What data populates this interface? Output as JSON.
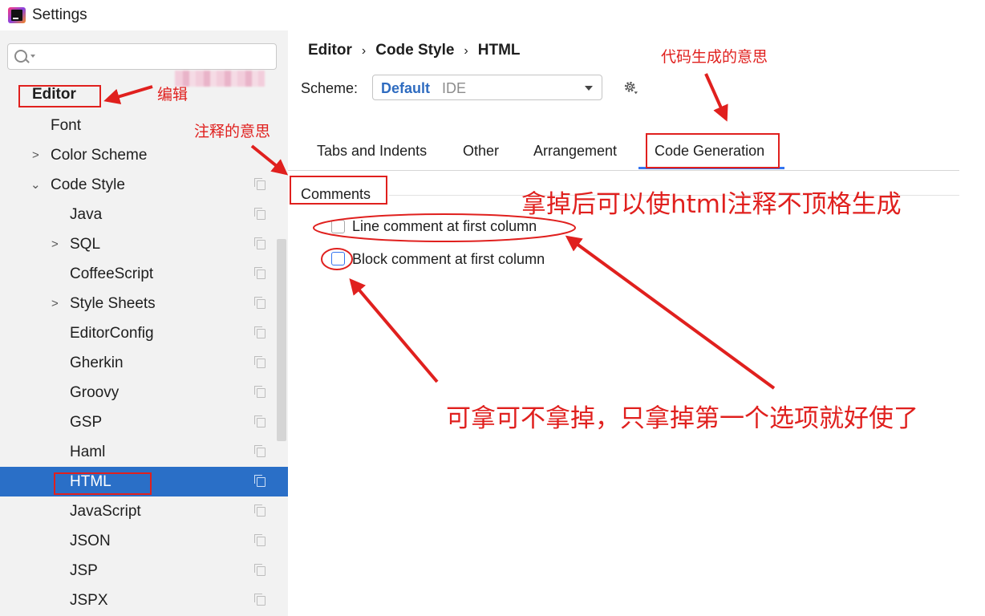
{
  "window": {
    "title": "Settings"
  },
  "search": {
    "placeholder": ""
  },
  "tree": [
    {
      "label": "Editor",
      "bold": true
    },
    {
      "label": "Font"
    },
    {
      "label": "Color Scheme"
    },
    {
      "label": "Code Style"
    },
    {
      "label": "Java"
    },
    {
      "label": "SQL"
    },
    {
      "label": "CoffeeScript"
    },
    {
      "label": "Style Sheets"
    },
    {
      "label": "EditorConfig"
    },
    {
      "label": "Gherkin"
    },
    {
      "label": "Groovy"
    },
    {
      "label": "GSP"
    },
    {
      "label": "Haml"
    },
    {
      "label": "HTML",
      "selected": true
    },
    {
      "label": "JavaScript"
    },
    {
      "label": "JSON"
    },
    {
      "label": "JSP"
    },
    {
      "label": "JSPX"
    }
  ],
  "breadcrumb": [
    "Editor",
    "Code Style",
    "HTML"
  ],
  "breadcrumb_sep": "›",
  "scheme": {
    "label": "Scheme:",
    "value": "Default",
    "sub": "IDE"
  },
  "tabs": [
    "Tabs and Indents",
    "Other",
    "Arrangement",
    "Code Generation"
  ],
  "active_tab": "Code Generation",
  "section": {
    "title": "Comments"
  },
  "options": [
    {
      "label": "Line comment at first column",
      "checked": false
    },
    {
      "label": "Block comment at first column",
      "checked": false
    }
  ],
  "annotations": {
    "editor": "编辑",
    "comment_meaning": "注释的意思",
    "code_generation_meaning": "代码生成的意思",
    "uncheck_note": "拿掉后可以使html注释不顶格生成",
    "optional_note": "可拿可不拿掉，只拿掉第一个选项就好使了"
  },
  "colors": {
    "accent": "#2a6fc7",
    "annotation": "#e0201e",
    "tab_underline": "#3574f0"
  }
}
